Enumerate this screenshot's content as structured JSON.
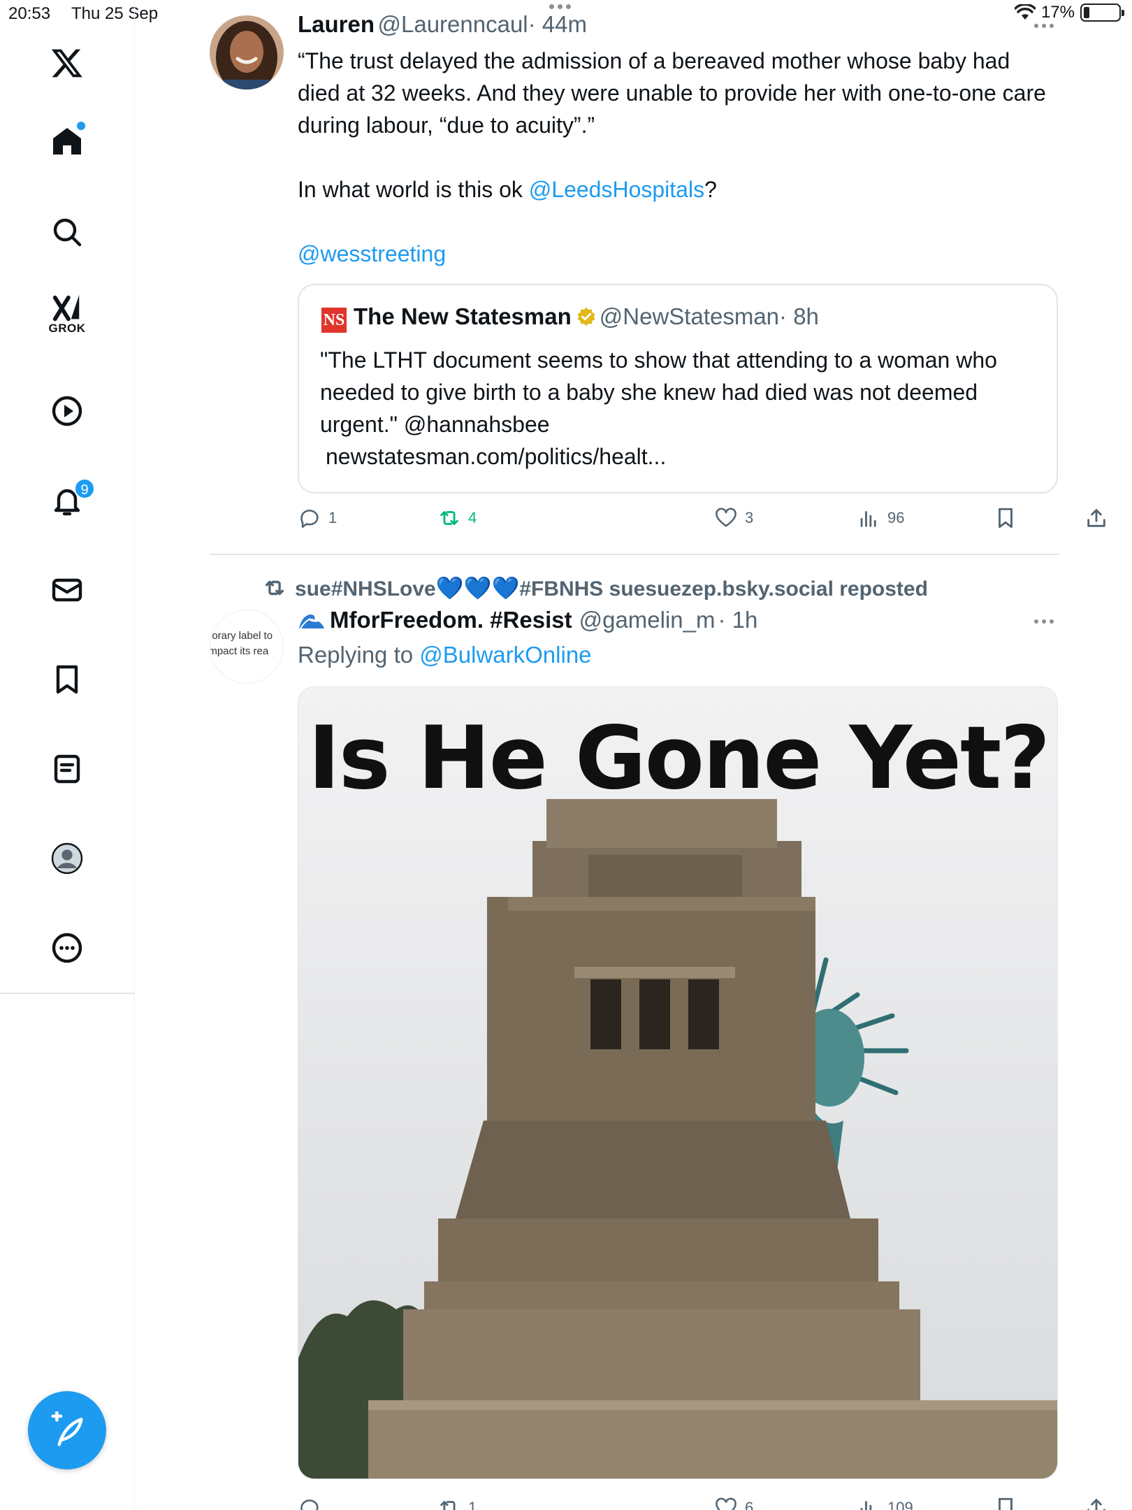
{
  "status_bar": {
    "time": "20:53",
    "date": "Thu 25 Sep",
    "battery": "17%",
    "battery_level": 0.17
  },
  "sidebar": {
    "notifications_badge": "9",
    "grok_label": "GROK",
    "items": [
      "x-logo",
      "home",
      "search",
      "grok",
      "video",
      "notifications",
      "messages",
      "bookmarks",
      "lists",
      "profile",
      "more"
    ]
  },
  "tweet1": {
    "name": "Lauren",
    "handle": "@Laurenncaul",
    "time": "· 44m",
    "text": "“The trust delayed the admission of a bereaved mother whose baby had died at 32 weeks. And they were unable to provide her with one-to-one care during labour, “due to acuity”.”",
    "line2_prefix": "In what world is this ok ",
    "mention1": "@LeedsHospitals",
    "line2_suffix": "?",
    "mention2": "@wesstreeting",
    "quote": {
      "logo": "NS",
      "name": "The New Statesman",
      "handle": "@NewStatesman",
      "time": "· 8h",
      "text": "\"The LTHT document seems to show that attending to a woman who needed to give birth to a baby she knew had died was not deemed urgent.\" @hannahsbee",
      "link": "newstatesman.com/politics/healt..."
    },
    "actions": {
      "replies": "1",
      "reposts": "4",
      "likes": "3",
      "views": "96"
    }
  },
  "tweet2": {
    "repost_user": "sue#NHSLove",
    "repost_hearts": "💙💙💙",
    "repost_rest": "#FBNHS suesuezep.bsky.social reposted",
    "avatar_text_line1": "porary label to",
    "avatar_text_line2": "impact its rea",
    "name": "MforFreedom. #Resist",
    "handle": "@gamelin_m",
    "time": "· 1h",
    "replying_prefix": "Replying to ",
    "replying_handle": "@BulwarkOnline",
    "image_caption": "Is He Gone Yet?",
    "actions": {
      "replies": "",
      "reposts": "1",
      "likes": "6",
      "views": "109"
    }
  },
  "colors": {
    "accent": "#1d9bf0",
    "repost_green": "#00ba7c",
    "secondary_text": "#536471"
  }
}
